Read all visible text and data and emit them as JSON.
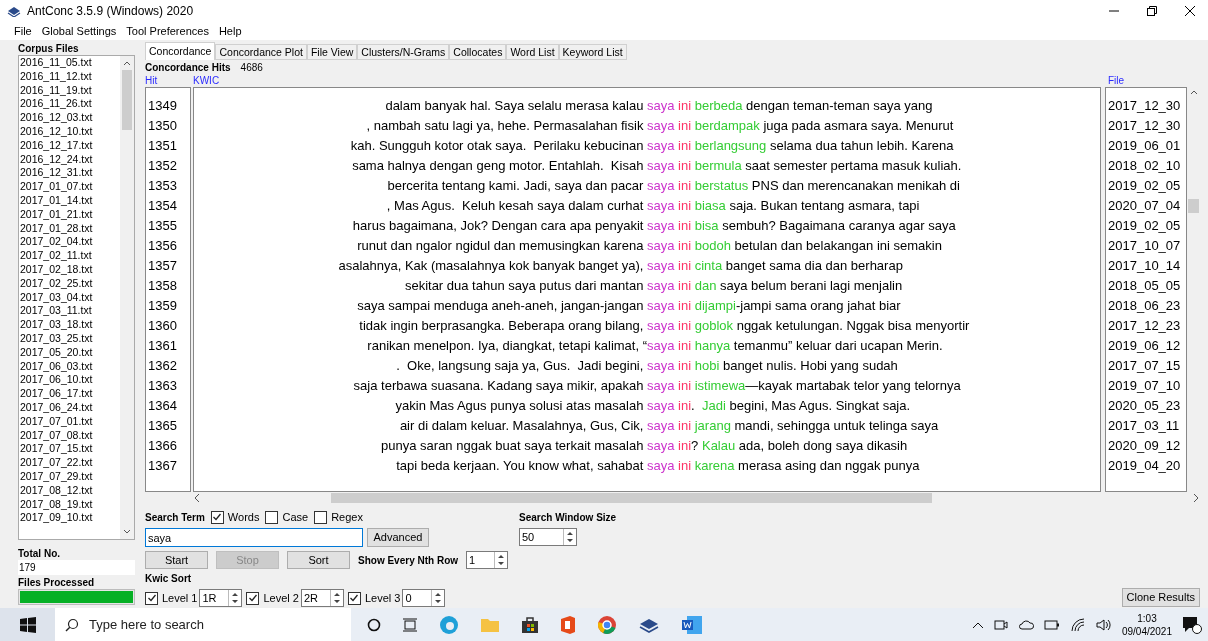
{
  "window": {
    "title": "AntConc 3.5.9 (Windows) 2020"
  },
  "menu": [
    "File",
    "Global Settings",
    "Tool Preferences",
    "Help"
  ],
  "sidebar": {
    "title": "Corpus Files",
    "files": [
      "2016_11_05.txt",
      "2016_11_12.txt",
      "2016_11_19.txt",
      "2016_11_26.txt",
      "2016_12_03.txt",
      "2016_12_10.txt",
      "2016_12_17.txt",
      "2016_12_24.txt",
      "2016_12_31.txt",
      "2017_01_07.txt",
      "2017_01_14.txt",
      "2017_01_21.txt",
      "2017_01_28.txt",
      "2017_02_04.txt",
      "2017_02_11.txt",
      "2017_02_18.txt",
      "2017_02_25.txt",
      "2017_03_04.txt",
      "2017_03_11.txt",
      "2017_03_18.txt",
      "2017_03_25.txt",
      "2017_05_20.txt",
      "2017_06_03.txt",
      "2017_06_10.txt",
      "2017_06_17.txt",
      "2017_06_24.txt",
      "2017_07_01.txt",
      "2017_07_08.txt",
      "2017_07_15.txt",
      "2017_07_22.txt",
      "2017_07_29.txt",
      "2017_08_12.txt",
      "2017_08_19.txt",
      "2017_09_10.txt"
    ],
    "total_label": "Total No.",
    "total": "179",
    "processed_label": "Files Processed",
    "processed": {
      "level": 1
    }
  },
  "tabs": [
    {
      "label": "Concordance",
      "selected": true
    },
    {
      "label": "Concordance Plot",
      "selected": false
    },
    {
      "label": "File View",
      "selected": false
    },
    {
      "label": "Clusters/N-Grams",
      "selected": false
    },
    {
      "label": "Collocates",
      "selected": false
    },
    {
      "label": "Word List",
      "selected": false
    },
    {
      "label": "Keyword List",
      "selected": false
    }
  ],
  "hits": {
    "label": "Concordance Hits",
    "value": "4686"
  },
  "columns": [
    "Hit",
    "KWIC",
    "File"
  ],
  "rows": [
    {
      "hit": "1349",
      "left": "dalam banyak hal. Saya selalu merasa kalau ",
      "node": "saya",
      "w1": "ini",
      "w2": "berbeda",
      "right": " dengan teman-teman saya yang",
      "file": "2017_12_30"
    },
    {
      "hit": "1350",
      "left": ", nambah satu lagi ya, hehe. Permasalahan fisik ",
      "node": "saya",
      "w1": "ini",
      "w2": "berdampak",
      "right": " juga pada asmara saya. Menurut",
      "file": "2017_12_30"
    },
    {
      "hit": "1351",
      "left": "kah. Sungguh kotor otak saya.  Perilaku kebucinan ",
      "node": "saya",
      "w1": "ini",
      "w2": "berlangsung",
      "right": " selama dua tahun lebih. Karena",
      "file": "2019_06_01"
    },
    {
      "hit": "1352",
      "left": "sama halnya dengan geng motor. Entahlah.  Kisah ",
      "node": "saya",
      "w1": "ini",
      "w2": "bermula",
      "right": " saat semester pertama masuk kuliah.",
      "file": "2018_02_10"
    },
    {
      "hit": "1353",
      "left": "bercerita tentang kami. Jadi, saya dan pacar ",
      "node": "saya",
      "w1": "ini",
      "w2": "berstatus",
      "right": " PNS dan merencanakan menikah di",
      "file": "2019_02_05"
    },
    {
      "hit": "1354",
      "left": ", Mas Agus.  Keluh kesah saya dalam curhat ",
      "node": "saya",
      "w1": "ini",
      "w2": "biasa",
      "right": " saja. Bukan tentang asmara, tapi",
      "file": "2020_07_04"
    },
    {
      "hit": "1355",
      "left": "harus bagaimana, Jok? Dengan cara apa penyakit ",
      "node": "saya",
      "w1": "ini",
      "w2": "bisa",
      "right": " sembuh? Bagaimana caranya agar saya",
      "file": "2019_02_05"
    },
    {
      "hit": "1356",
      "left": "runut dan ngalor ngidul dan memusingkan karena ",
      "node": "saya",
      "w1": "ini",
      "w2": "bodoh",
      "right": " betulan dan belakangan ini semakin",
      "file": "2017_10_07"
    },
    {
      "hit": "1357",
      "left": "asalahnya, Kak (masalahnya kok banyak banget ya), ",
      "node": "saya",
      "w1": "ini",
      "w2": "cinta",
      "right": " banget sama dia dan berharap",
      "file": "2017_10_14"
    },
    {
      "hit": "1358",
      "left": "sekitar dua tahun saya putus dari mantan ",
      "node": "saya",
      "w1": "ini",
      "w2": "dan",
      "right": " saya belum berani lagi menjalin",
      "file": "2018_05_05"
    },
    {
      "hit": "1359",
      "left": "saya sampai menduga aneh-aneh, jangan-jangan ",
      "node": "saya",
      "w1": "ini",
      "w2": "dijampi",
      "right": "-jampi sama orang jahat biar",
      "file": "2018_06_23"
    },
    {
      "hit": "1360",
      "left": "tidak ingin berprasangka. Beberapa orang bilang, ",
      "node": "saya",
      "w1": "ini",
      "w2": "goblok",
      "right": " nggak ketulungan. Nggak bisa menyortir",
      "file": "2017_12_23"
    },
    {
      "hit": "1361",
      "left": "ranikan menelpon. Iya, diangkat, tetapi kalimat, “",
      "node": "saya",
      "w1": "ini",
      "w2": "hanya",
      "right": " temanmu” keluar dari ucapan Merin.",
      "file": "2019_06_12"
    },
    {
      "hit": "1362",
      "left": ".  Oke, langsung saja ya, Gus.  Jadi begini, ",
      "node": "saya",
      "w1": "ini",
      "w2": "hobi",
      "right": " banget nulis. Hobi yang sudah",
      "file": "2017_07_15"
    },
    {
      "hit": "1363",
      "left": "saja terbawa suasana. Kadang saya mikir, apakah ",
      "node": "saya",
      "w1": "ini",
      "w2": "istimewa",
      "right": "—kayak martabak telor yang telornya",
      "file": "2019_07_10"
    },
    {
      "hit": "1364",
      "left": "yakin Mas Agus punya solusi atas masalah ",
      "node": "saya",
      "w1": "ini",
      "after": ". ",
      "w2": "Jadi",
      "right": " begini, Mas Agus. Singkat saja.",
      "file": "2020_05_23"
    },
    {
      "hit": "1365",
      "left": "air di dalam keluar. Masalahnya, Gus, Cik, ",
      "node": "saya",
      "w1": "ini",
      "w2": "jarang",
      "right": " mandi, sehingga untuk telinga saya",
      "file": "2017_03_11"
    },
    {
      "hit": "1366",
      "left": "punya saran nggak buat saya terkait masalah ",
      "node": "saya",
      "w1": "ini",
      "after": "?",
      "w2": "Kalau",
      "right": " ada, boleh dong saya dikasih",
      "file": "2020_09_12"
    },
    {
      "hit": "1367",
      "left": "tapi beda kerjaan. You know what, sahabat ",
      "node": "saya",
      "w1": "ini",
      "w2": "karena",
      "right": " merasa asing dan nggak punya",
      "file": "2019_04_20"
    }
  ],
  "search": {
    "label": "Search Term",
    "options": [
      {
        "label": "Words",
        "checked": true
      },
      {
        "label": "Case",
        "checked": false
      },
      {
        "label": "Regex",
        "checked": false
      }
    ],
    "value": "saya",
    "advanced": "Advanced"
  },
  "actions": [
    {
      "label": "Start",
      "disabled": false
    },
    {
      "label": "Stop",
      "disabled": true
    },
    {
      "label": "Sort",
      "disabled": false
    }
  ],
  "nth": {
    "label": "Show Every Nth Row",
    "value": "1"
  },
  "window_size": {
    "label": "Search Window Size",
    "value": "50"
  },
  "kwic_sort": {
    "label": "Kwic Sort",
    "levels": [
      {
        "label": "Level 1",
        "checked": true,
        "value": "1R"
      },
      {
        "label": "Level 2",
        "checked": true,
        "value": "2R"
      },
      {
        "label": "Level 3",
        "checked": true,
        "value": "0"
      }
    ]
  },
  "clone": "Clone Results",
  "taskbar": {
    "search_placeholder": "Type here to search",
    "time": "1:03",
    "date": "09/04/2021"
  }
}
